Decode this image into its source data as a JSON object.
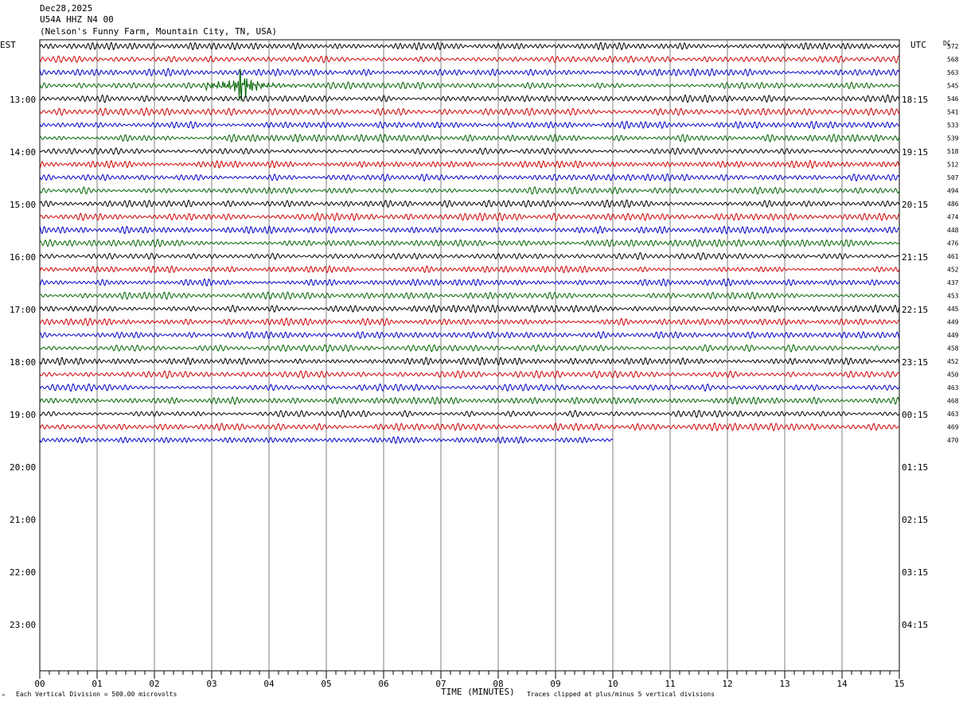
{
  "header": {
    "date": "Dec28,2025",
    "station": "U54A HHZ N4 00",
    "location": "(Nelson's Funny Farm, Mountain City, TN, USA)"
  },
  "axis": {
    "left_tz": "EST",
    "right_tz": "UTC",
    "dc_label": "DC",
    "xlabel": "TIME (MINUTES)"
  },
  "footer": {
    "left_note": "Each Vertical Division =  500.00 microvolts",
    "right_note": "Traces clipped at plus/minus 5 vertical divisions"
  },
  "chart_data": {
    "type": "line",
    "title": "U54A HHZ N4 00",
    "xlabel": "TIME (MINUTES)",
    "x_ticks": [
      "00",
      "01",
      "02",
      "03",
      "04",
      "05",
      "06",
      "07",
      "08",
      "09",
      "10",
      "11",
      "12",
      "13",
      "14",
      "15"
    ],
    "xlim": [
      0,
      15
    ],
    "trace_colors": [
      "#000000",
      "#d00000",
      "#0000c8",
      "#006400"
    ],
    "left_time_labels": [
      "13:00",
      "14:00",
      "15:00",
      "16:00",
      "17:00",
      "18:00",
      "19:00",
      "20:00",
      "21:00",
      "22:00",
      "23:00"
    ],
    "right_time_labels": [
      "18:15",
      "19:15",
      "20:15",
      "21:15",
      "22:15",
      "23:15",
      "00:15",
      "01:15",
      "02:15",
      "03:15",
      "04:15"
    ],
    "dc_offsets": [
      572,
      568,
      563,
      545,
      546,
      541,
      533,
      539,
      518,
      512,
      507,
      494,
      486,
      474,
      448,
      476,
      461,
      452,
      437,
      453,
      445,
      449,
      449,
      458,
      452,
      450,
      463,
      468,
      463,
      469,
      470
    ],
    "num_traces": 31,
    "last_trace_end_minute": 10,
    "event": {
      "trace_index": 3,
      "start_minute": 2.9,
      "peak_minute": 3.45,
      "end_minute": 5.0
    }
  }
}
